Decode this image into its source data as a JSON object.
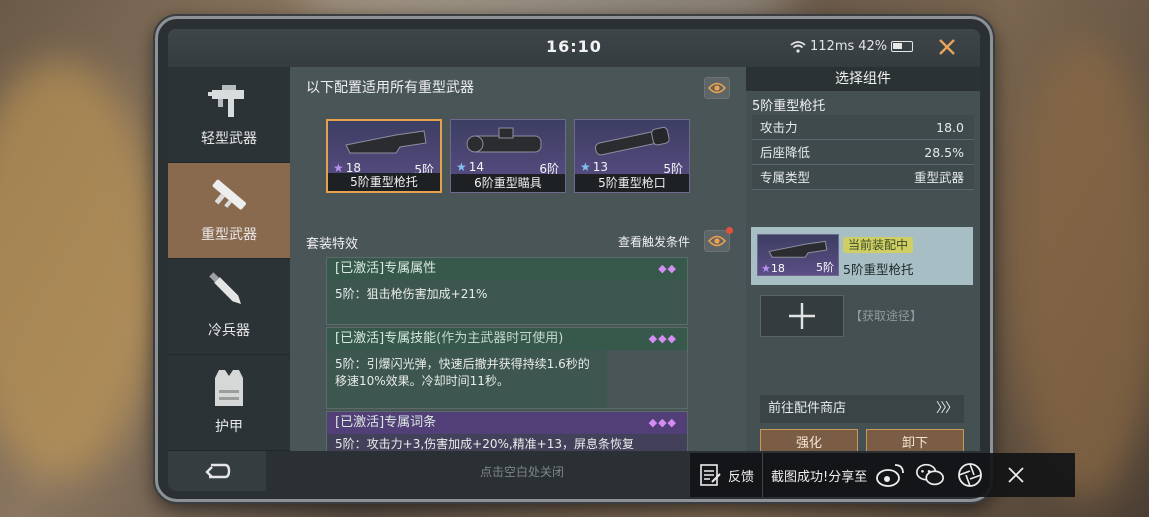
{
  "status": {
    "time": "16:10",
    "ping": "112ms",
    "battery": "42%"
  },
  "sidebar": {
    "items": [
      {
        "label": "轻型武器",
        "icon": "smg-icon",
        "active": false
      },
      {
        "label": "重型武器",
        "icon": "rocket-launcher-icon",
        "active": true
      },
      {
        "label": "冷兵器",
        "icon": "knife-icon",
        "active": false
      },
      {
        "label": "护甲",
        "icon": "armor-vest-icon",
        "active": false
      }
    ]
  },
  "main": {
    "title": "以下配置适用所有重型武器",
    "attachments": [
      {
        "stars": "18",
        "tier": "5阶",
        "name": "5阶重型枪托",
        "selected": true
      },
      {
        "stars": "14",
        "tier": "6阶",
        "name": "6阶重型瞄具",
        "selected": false
      },
      {
        "stars": "13",
        "tier": "5阶",
        "name": "5阶重型枪口",
        "selected": false
      }
    ],
    "set_title": "套装特效",
    "trigger_link": "查看触发条件",
    "sets": [
      {
        "status": "[已激活]",
        "name": "专属属性",
        "note": "",
        "text": "5阶：狙击枪伤害加成+21%",
        "dots": "◆◆"
      },
      {
        "status": "[已激活]",
        "name": "专属技能",
        "note": "(作为主武器时可使用)",
        "text": "5阶：引爆闪光弹，快速后撤并获得持续1.6秒的移速10%效果。冷却时间11秒。",
        "dots": "◆◆◆"
      },
      {
        "status": "[已激活]",
        "name": "专属词条",
        "note": "",
        "text": "5阶：攻击力+3,伤害加成+20%,精准+13，屏息条恢复",
        "dots": "◆◆◆"
      }
    ]
  },
  "right_panel": {
    "header": "选择组件",
    "item_title": "5阶重型枪托",
    "stats": [
      {
        "label": "攻击力",
        "value": "18.0"
      },
      {
        "label": "后座降低",
        "value": "28.5%"
      },
      {
        "label": "专属类型",
        "value": "重型武器"
      }
    ],
    "equipped": {
      "stars": "18",
      "tier": "5阶",
      "badge": "当前装配中",
      "name": "5阶重型枪托"
    },
    "acquire": "【获取途径】",
    "shop_link": "前往配件商店",
    "shop_arrows": "〉〉〉",
    "buttons": {
      "upgrade": "强化",
      "unequip": "卸下"
    }
  },
  "bottom": {
    "close_hint": "点击空白处关闭"
  },
  "share_bar": {
    "feedback": "反馈",
    "message": "截图成功!分享至"
  },
  "colors": {
    "accent": "#e6a14a",
    "active_tab": "#8a6a4e",
    "green_set": "#36594b",
    "purple_set": "#523f78",
    "badge": "#d0cf63"
  }
}
